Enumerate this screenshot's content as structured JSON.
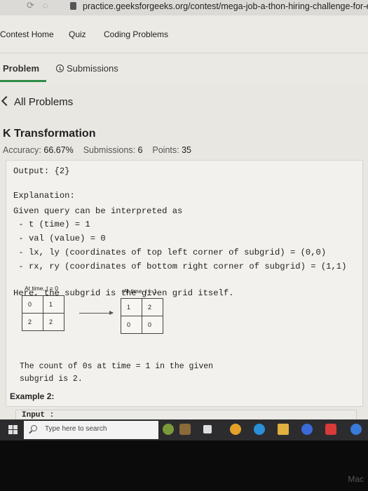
{
  "browser": {
    "url": "practice.geeksforgeeks.org/contest/mega-job-a-thon-hiring-challenge-for-e"
  },
  "site_nav": {
    "items": [
      "Contest Home",
      "Quiz",
      "Coding Problems"
    ]
  },
  "tabs": {
    "problem": "Problem",
    "submissions": "Submissions"
  },
  "back_link": "All Problems",
  "problem": {
    "title": "K Transformation",
    "accuracy_label": "Accuracy:",
    "accuracy_value": "66.67%",
    "submissions_label": "Submissions:",
    "submissions_value": "6",
    "points_label": "Points:",
    "points_value": "35"
  },
  "content": {
    "output_line": "Output: {2}",
    "explanation_heading": "Explanation:",
    "explanation_lines": [
      "Given query can be interpreted as",
      " - t (time) = 1",
      " - val (value) = 0",
      " - lx, ly (coordinates of top left corner of subgrid) = (0,0)",
      " - rx, ry (coordinates of bottom right corner of subgrid) = (1,1)"
    ],
    "subgrid_note": "Here, the subgrid is the given grid itself.",
    "grid0": {
      "label": "At time, t = 0",
      "rows": [
        [
          "0",
          "1"
        ],
        [
          "2",
          "2"
        ]
      ]
    },
    "grid1": {
      "label": "At time, t = 1",
      "rows": [
        [
          "1",
          "2"
        ],
        [
          "0",
          "0"
        ]
      ]
    },
    "count_lines": [
      "The count of 0s at time = 1 in the given",
      "subgrid is 2."
    ],
    "example2_heading": "Example 2:",
    "input_label": "Input :"
  },
  "taskbar": {
    "search_placeholder": "Type here to search"
  },
  "bezel_brand": "Mac"
}
